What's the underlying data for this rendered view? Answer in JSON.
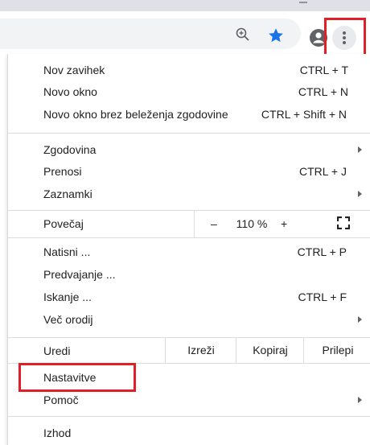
{
  "menu": {
    "new_tab": {
      "label": "Nov zavihek",
      "shortcut": "CTRL + T"
    },
    "new_window": {
      "label": "Novo okno",
      "shortcut": "CTRL + N"
    },
    "incognito": {
      "label": "Novo okno brez beleženja zgodovine",
      "shortcut": "CTRL + Shift + N"
    },
    "history": {
      "label": "Zgodovina"
    },
    "downloads": {
      "label": "Prenosi",
      "shortcut": "CTRL + J"
    },
    "bookmarks": {
      "label": "Zaznamki"
    },
    "zoom": {
      "label": "Povečaj",
      "minus": "–",
      "value": "110 %",
      "plus": "+"
    },
    "print": {
      "label": "Natisni ...",
      "shortcut": "CTRL + P"
    },
    "cast": {
      "label": "Predvajanje ..."
    },
    "find": {
      "label": "Iskanje ...",
      "shortcut": "CTRL + F"
    },
    "more_tools": {
      "label": "Več orodij"
    },
    "edit": {
      "label": "Uredi",
      "cut": "Izreži",
      "copy": "Kopiraj",
      "paste": "Prilepi"
    },
    "settings": {
      "label": "Nastavitve"
    },
    "help": {
      "label": "Pomoč"
    },
    "exit": {
      "label": "Izhod"
    }
  },
  "icons": {
    "zoom": "zoom-in-icon",
    "bookmark": "star-icon",
    "profile": "profile-icon",
    "menu": "three-dot-menu-icon",
    "fullscreen": "fullscreen-icon"
  },
  "colors": {
    "highlight": "#e01f26",
    "star": "#1a73e8",
    "toolbar_bg": "#f1f3f4"
  }
}
